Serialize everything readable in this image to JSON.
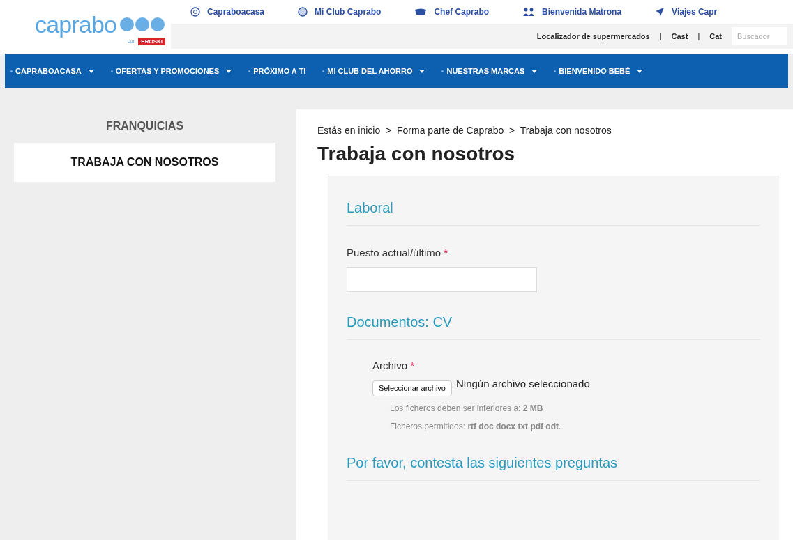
{
  "logo": {
    "name": "caprabo",
    "tagline": "con",
    "partner": "EROSKI"
  },
  "top_links": [
    {
      "label": "Capraboacasa"
    },
    {
      "label": "Mi Club Caprabo"
    },
    {
      "label": "Chef Caprabo"
    },
    {
      "label": "Bienvenida Matrona"
    },
    {
      "label": "Viajes Capr"
    }
  ],
  "utility": [
    {
      "label": "Localizador de supermercados",
      "selected": false
    },
    {
      "label": "|",
      "kind": "sep"
    },
    {
      "label": "Cast",
      "selected": true
    },
    {
      "label": "|",
      "kind": "sep"
    },
    {
      "label": "Cat",
      "selected": false
    }
  ],
  "search": {
    "placeholder": "Buscador"
  },
  "nav": [
    {
      "label": "CAPRABOACASA",
      "dropdown": true
    },
    {
      "label": "OFERTAS Y PROMOCIONES",
      "dropdown": true
    },
    {
      "label": "PRÓXIMO A TI",
      "dropdown": false
    },
    {
      "label": "MI CLUB DEL AHORRO",
      "dropdown": true
    },
    {
      "label": "NUESTRAS MARCAS",
      "dropdown": true
    },
    {
      "label": "BIENVENIDO BEBÉ",
      "dropdown": true
    }
  ],
  "sidebar": [
    {
      "label": "FRANQUICIAS",
      "selected": false
    },
    {
      "label": "TRABAJA CON NOSOTROS",
      "selected": true
    }
  ],
  "breadcrumb": "Estás en inicio  >  Forma parte de Caprabo  >  Trabaja con nosotros",
  "title": "Trabaja con nosotros",
  "sections": [
    {
      "title": "Laboral",
      "field_label": "Puesto actual/último",
      "required": "*"
    },
    {
      "title": "Documentos: CV",
      "field_label": "Archivo",
      "required": "*",
      "button": "Seleccionar archivo",
      "file_status": "Ningún archivo seleccionado",
      "notes": [
        "Los ficheros deben ser inferiores a: **2 MB**",
        "Ficheros permitidos: **rtf doc docx txt pdf odt**."
      ]
    },
    {
      "title": "Por favor, contesta las siguientes preguntas"
    }
  ]
}
